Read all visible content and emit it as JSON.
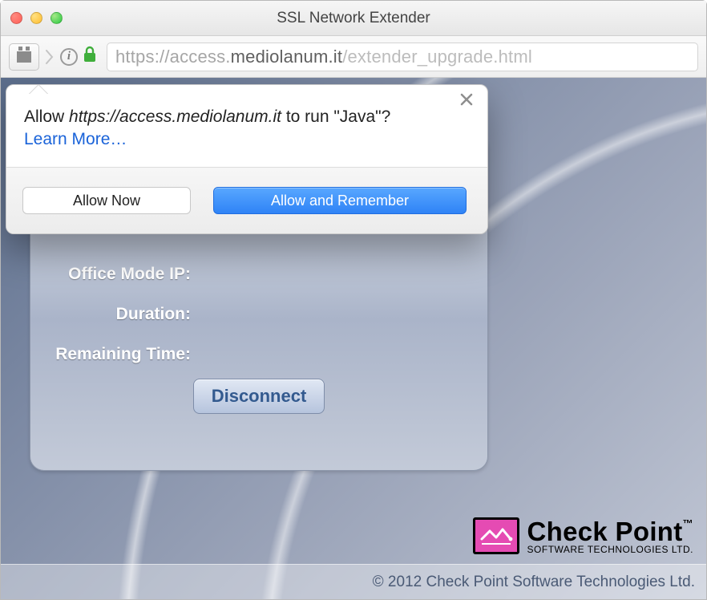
{
  "window": {
    "title": "SSL Network Extender"
  },
  "url": {
    "scheme": "https://",
    "host_prefix": "access.",
    "host_domain": "mediolanum.it",
    "path": "/extender_upgrade.html"
  },
  "popup": {
    "msg_prefix": "Allow ",
    "site": "https://access.mediolanum.it",
    "msg_suffix": " to run \"Java\"?",
    "learn_more": "Learn More…",
    "allow_now": "Allow Now",
    "allow_remember": "Allow and Remember"
  },
  "panel": {
    "labels": {
      "office_mode_ip": "Office Mode IP:",
      "duration": "Duration:",
      "remaining_time": "Remaining Time:"
    },
    "disconnect": "Disconnect"
  },
  "brand": {
    "name": "Check Point",
    "sub": "SOFTWARE TECHNOLOGIES LTD."
  },
  "copyright": "© 2012 Check Point Software Technologies Ltd."
}
